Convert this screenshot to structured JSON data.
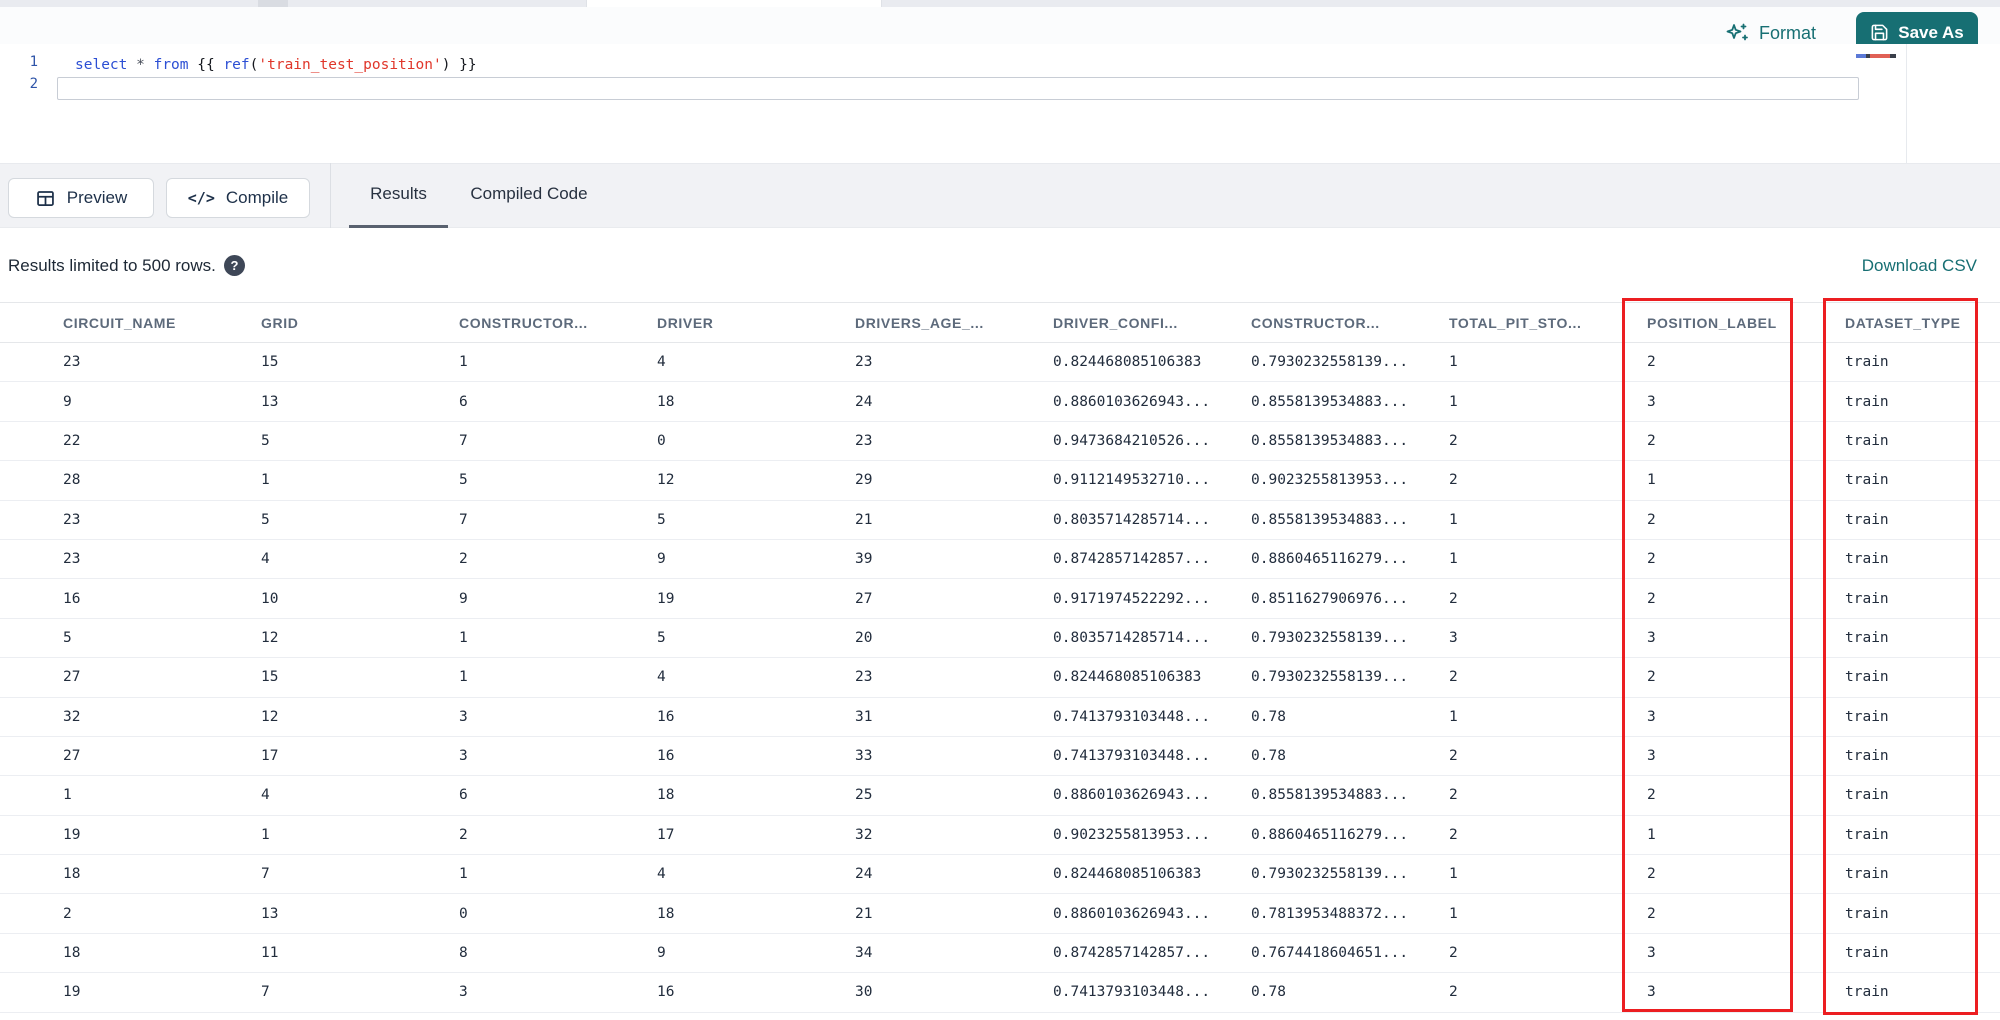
{
  "toolbar": {
    "format_label": "Format",
    "save_as_label": "Save As"
  },
  "editor": {
    "line_numbers": [
      "1",
      "2"
    ],
    "tokens": [
      "select",
      " ",
      "*",
      " ",
      "from",
      " {{ ",
      "ref",
      "(",
      "'train_test_position'",
      ")",
      " }}"
    ],
    "full_line": "select * from {{ ref('train_test_position') }}"
  },
  "results_panel": {
    "preview_label": "Preview",
    "compile_label": "Compile",
    "compile_glyph": "</>",
    "tabs": [
      {
        "label": "Results",
        "active": true
      },
      {
        "label": "Compiled Code",
        "active": false
      }
    ],
    "limit_notice": "Results limited to 500 rows.",
    "help_glyph": "?",
    "download_csv_label": "Download CSV"
  },
  "table": {
    "headers": [
      "CIRCUIT_NAME",
      "GRID",
      "CONSTRUCTOR...",
      "DRIVER",
      "DRIVERS_AGE_...",
      "DRIVER_CONFI...",
      "CONSTRUCTOR...",
      "TOTAL_PIT_STO...",
      "POSITION_LABEL",
      "DATASET_TYPE"
    ],
    "rows": [
      [
        "23",
        "15",
        "1",
        "4",
        "23",
        "0.824468085106383",
        "0.7930232558139...",
        "1",
        "2",
        "train"
      ],
      [
        "9",
        "13",
        "6",
        "18",
        "24",
        "0.8860103626943...",
        "0.8558139534883...",
        "1",
        "3",
        "train"
      ],
      [
        "22",
        "5",
        "7",
        "0",
        "23",
        "0.9473684210526...",
        "0.8558139534883...",
        "2",
        "2",
        "train"
      ],
      [
        "28",
        "1",
        "5",
        "12",
        "29",
        "0.9112149532710...",
        "0.9023255813953...",
        "2",
        "1",
        "train"
      ],
      [
        "23",
        "5",
        "7",
        "5",
        "21",
        "0.8035714285714...",
        "0.8558139534883...",
        "1",
        "2",
        "train"
      ],
      [
        "23",
        "4",
        "2",
        "9",
        "39",
        "0.8742857142857...",
        "0.8860465116279...",
        "1",
        "2",
        "train"
      ],
      [
        "16",
        "10",
        "9",
        "19",
        "27",
        "0.9171974522292...",
        "0.8511627906976...",
        "2",
        "2",
        "train"
      ],
      [
        "5",
        "12",
        "1",
        "5",
        "20",
        "0.8035714285714...",
        "0.7930232558139...",
        "3",
        "3",
        "train"
      ],
      [
        "27",
        "15",
        "1",
        "4",
        "23",
        "0.824468085106383",
        "0.7930232558139...",
        "2",
        "2",
        "train"
      ],
      [
        "32",
        "12",
        "3",
        "16",
        "31",
        "0.7413793103448...",
        "0.78",
        "1",
        "3",
        "train"
      ],
      [
        "27",
        "17",
        "3",
        "16",
        "33",
        "0.7413793103448...",
        "0.78",
        "2",
        "3",
        "train"
      ],
      [
        "1",
        "4",
        "6",
        "18",
        "25",
        "0.8860103626943...",
        "0.8558139534883...",
        "2",
        "2",
        "train"
      ],
      [
        "19",
        "1",
        "2",
        "17",
        "32",
        "0.9023255813953...",
        "0.8860465116279...",
        "2",
        "1",
        "train"
      ],
      [
        "18",
        "7",
        "1",
        "4",
        "24",
        "0.824468085106383",
        "0.7930232558139...",
        "1",
        "2",
        "train"
      ],
      [
        "2",
        "13",
        "0",
        "18",
        "21",
        "0.8860103626943...",
        "0.7813953488372...",
        "1",
        "2",
        "train"
      ],
      [
        "18",
        "11",
        "8",
        "9",
        "34",
        "0.8742857142857...",
        "0.7674418604651...",
        "2",
        "3",
        "train"
      ],
      [
        "19",
        "7",
        "3",
        "16",
        "30",
        "0.7413793103448...",
        "0.78",
        "2",
        "3",
        "train"
      ]
    ]
  },
  "annotations": {
    "highlighted_columns": [
      "POSITION_LABEL",
      "DATASET_TYPE"
    ],
    "highlight_color": "#ec1e21"
  },
  "colors": {
    "accent_teal": "#176f73",
    "band_gray": "#f1f2f5",
    "header_text": "#5d6a7b",
    "cell_text": "#222d3d"
  },
  "icons": {
    "format": "sparkles",
    "save_as": "floppy-disk",
    "preview": "table-grid",
    "compile": "code-brackets",
    "help": "question-mark"
  }
}
